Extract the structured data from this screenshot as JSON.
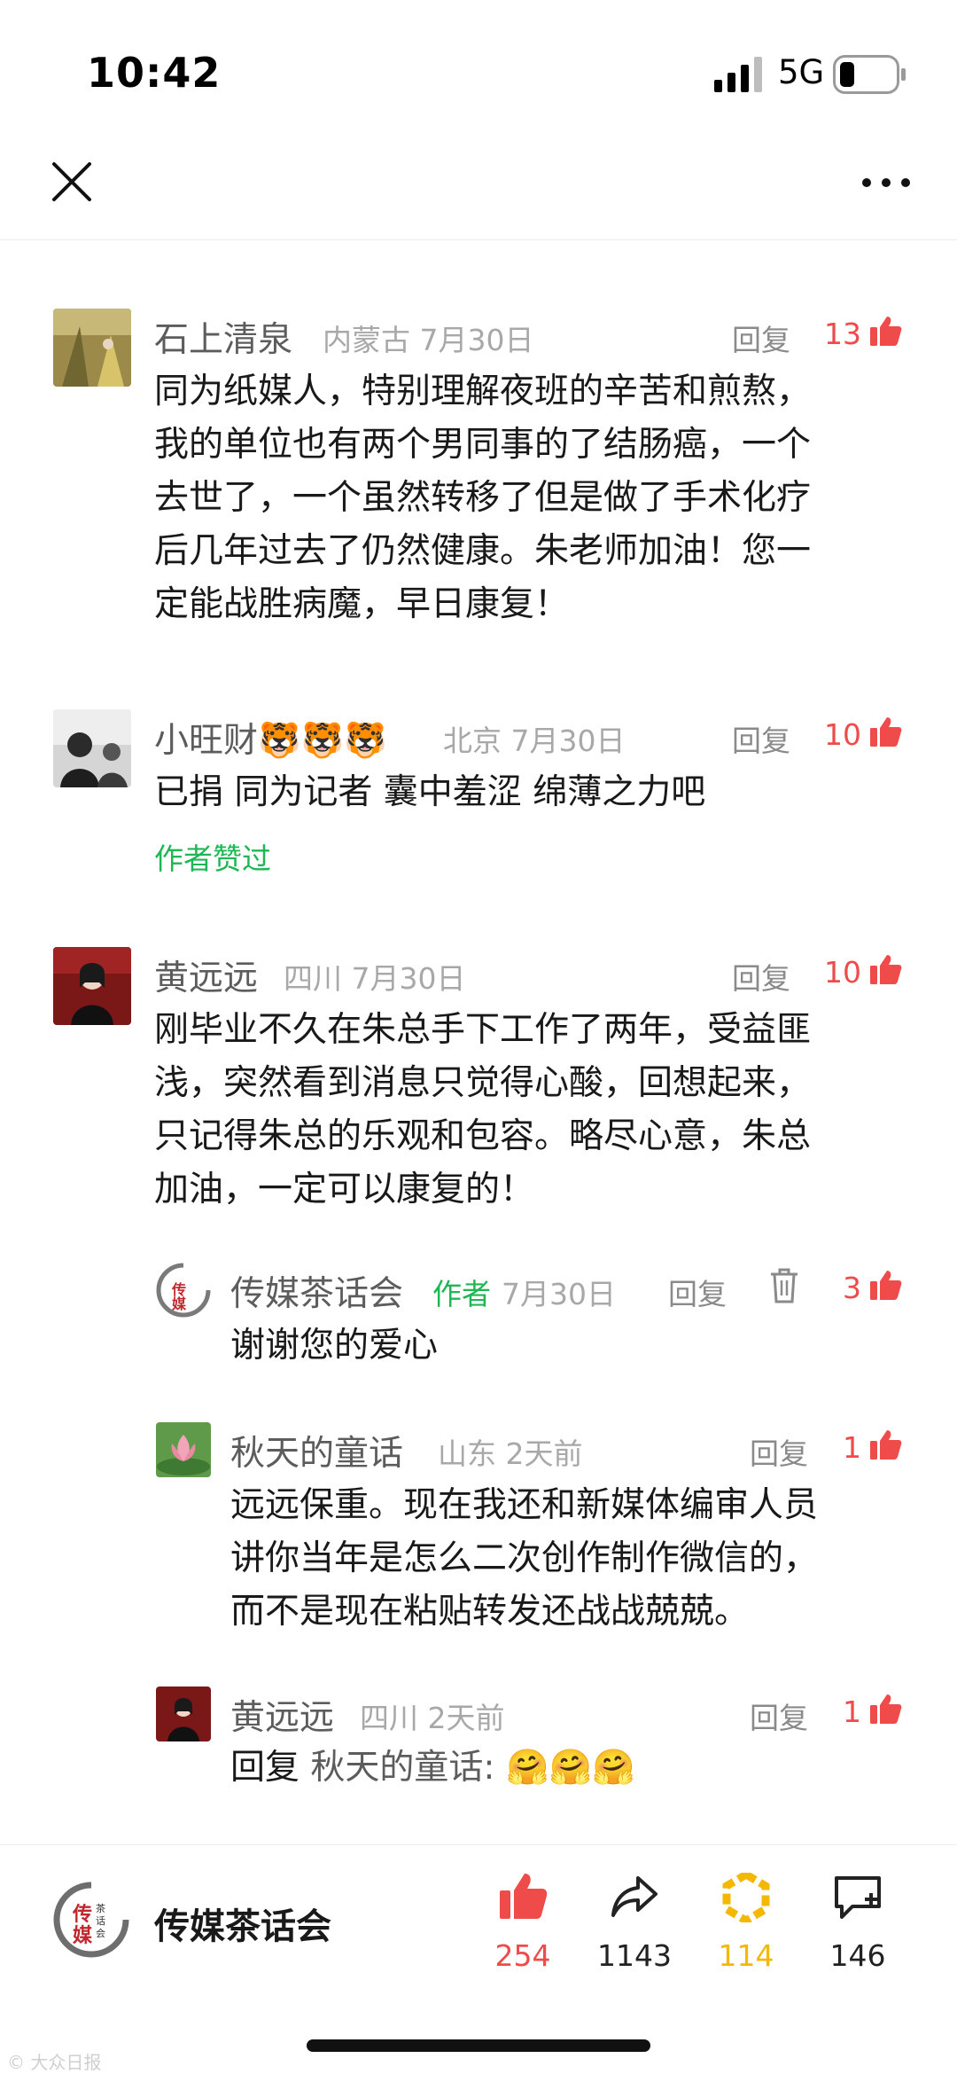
{
  "status_bar": {
    "time": "10:42",
    "network": "5G"
  },
  "nav": {
    "close_icon": "close-icon",
    "more_icon": "more-icon"
  },
  "comments": [
    {
      "name": "石上清泉",
      "meta": "内蒙古  7月30日",
      "reply": "回复",
      "likes": "13",
      "lines": [
        "同为纸媒人，特别理解夜班的辛苦和煎熬，",
        "我的单位也有两个男同事的了结肠癌，一个",
        "去世了，一个虽然转移了但是做了手术化疗",
        "后几年过去了仍然健康。朱老师加油！您一",
        "定能战胜病魔，早日康复！"
      ]
    },
    {
      "name": "小旺财🐯🐯🐯",
      "meta": "北京  7月30日",
      "reply": "回复",
      "likes": "10",
      "lines": [
        "已捐 同为记者 囊中羞涩 绵薄之力吧"
      ],
      "author_liked": "作者赞过"
    },
    {
      "name": "黄远远",
      "meta": "四川  7月30日",
      "reply": "回复",
      "likes": "10",
      "lines": [
        "刚毕业不久在朱总手下工作了两年，受益匪",
        "浅，突然看到消息只觉得心酸，回想起来，",
        "只记得朱总的乐观和包容。略尽心意，朱总",
        "加油，一定可以康复的！"
      ]
    }
  ],
  "replies": [
    {
      "name": "传媒茶话会",
      "author_tag": "作者",
      "meta": "7月30日",
      "reply": "回复",
      "likes": "3",
      "lines": [
        "谢谢您的爱心"
      ]
    },
    {
      "name": "秋天的童话",
      "meta": "山东  2天前",
      "reply": "回复",
      "likes": "1",
      "lines": [
        "远远保重。现在我还和新媒体编审人员",
        "讲你当年是怎么二次创作制作微信的，",
        "而不是现在粘贴转发还战战兢兢。"
      ]
    },
    {
      "name": "黄远远",
      "meta": "四川  2天前",
      "reply": "回复",
      "likes": "1",
      "reply_prefix": "回复",
      "reply_target": "秋天的童话:",
      "emoji": "🤗🤗🤗"
    }
  ],
  "bottom_bar": {
    "account_name": "传媒茶话会",
    "logo_text": "传媒",
    "logo_small": "茶话会",
    "like_count": "254",
    "share_count": "1143",
    "wow_count": "114",
    "comment_count": "146"
  },
  "colors": {
    "like": "#f04b4b",
    "author": "#1fb755",
    "wow": "#f5b800"
  },
  "watermark": "© 大众日报"
}
